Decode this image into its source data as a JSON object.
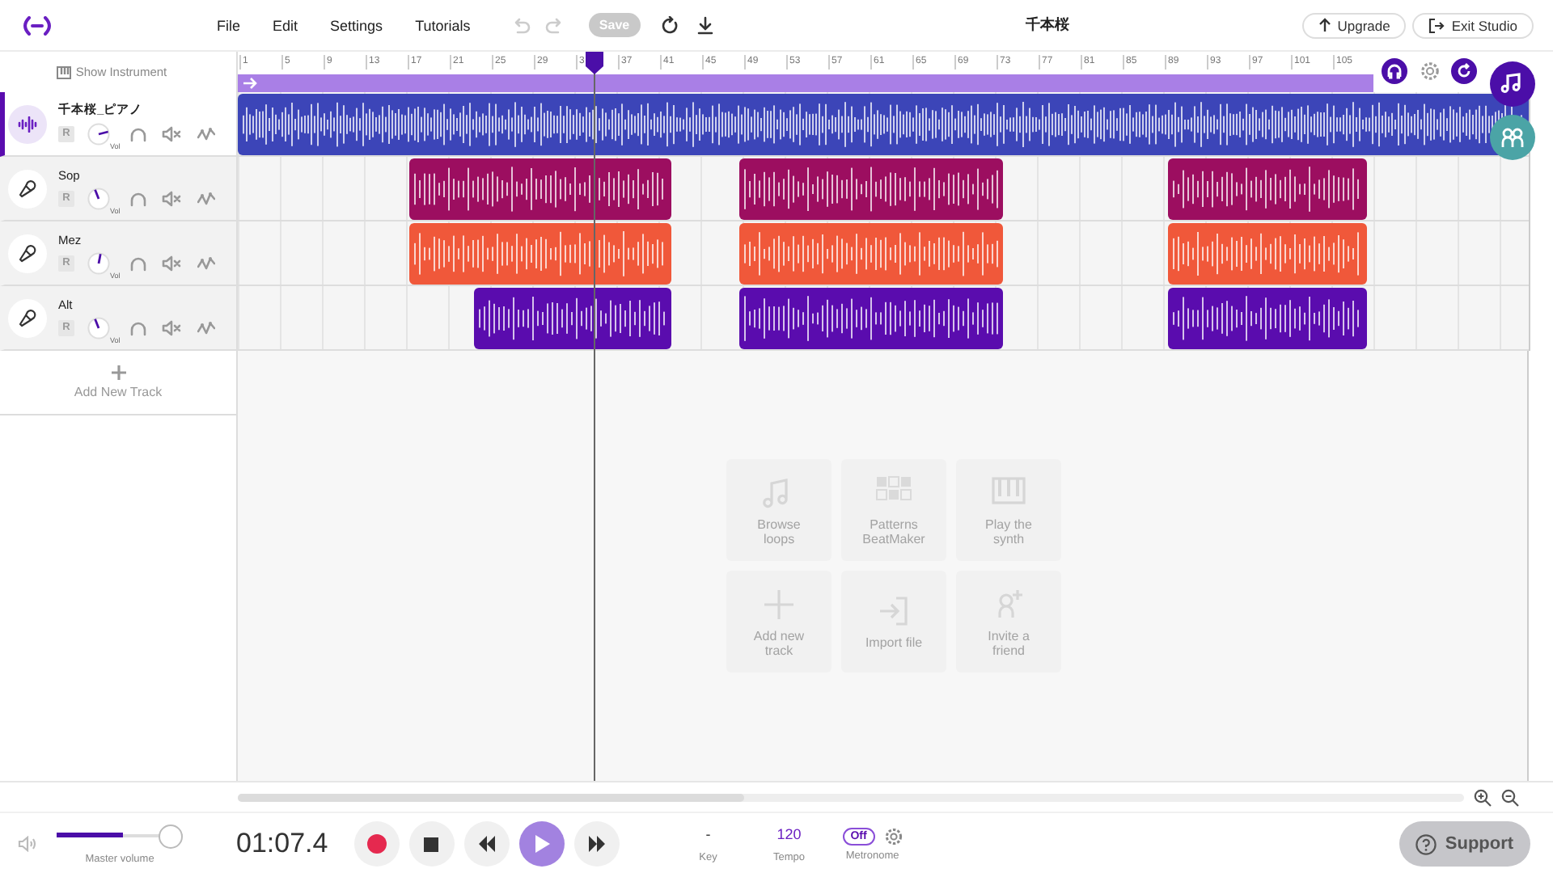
{
  "top_bar": {
    "menu": [
      "File",
      "Edit",
      "Settings",
      "Tutorials"
    ],
    "save": "Save",
    "project_title": "千本桜",
    "upgrade": "Upgrade",
    "exit": "Exit Studio"
  },
  "track_panel": {
    "show_instrument": "Show Instrument",
    "add_track": "Add New Track"
  },
  "ruler": {
    "marks": [
      "1",
      "5",
      "9",
      "13",
      "17",
      "21",
      "25",
      "29",
      "3",
      "37",
      "41",
      "45",
      "49",
      "53",
      "57",
      "61",
      "65",
      "69",
      "73",
      "77",
      "81",
      "85",
      "89",
      "93",
      "97",
      "101",
      "105"
    ]
  },
  "tracks": [
    {
      "name": "千本桜_ピアノ",
      "kind": "instrument",
      "selected": true,
      "record": "R",
      "volume_label": "Vol",
      "level": 0.78,
      "color": "#3c45b8"
    },
    {
      "name": "Sop",
      "kind": "vocal",
      "selected": false,
      "record": "R",
      "volume_label": "Vol",
      "level": 0.42,
      "color": "#9c0e60"
    },
    {
      "name": "Mez",
      "kind": "vocal",
      "selected": false,
      "record": "R",
      "volume_label": "Vol",
      "level": 0.54,
      "color": "#f0583a"
    },
    {
      "name": "Alt",
      "kind": "vocal",
      "selected": false,
      "record": "R",
      "volume_label": "Vol",
      "level": 0.42,
      "color": "#5a0cae"
    }
  ],
  "quick_actions": [
    {
      "kind": "loops",
      "label": "Browse loops"
    },
    {
      "kind": "patterns",
      "label": "Patterns BeatMaker"
    },
    {
      "kind": "synth",
      "label": "Play the synth"
    },
    {
      "kind": "add",
      "label": "Add new track"
    },
    {
      "kind": "import",
      "label": "Import file"
    },
    {
      "kind": "invite",
      "label": "Invite a friend"
    }
  ],
  "transport": {
    "master_volume_label": "Master volume",
    "level": 0.53,
    "time": "01:07.4",
    "key": "-",
    "key_label": "Key",
    "tempo": "120",
    "tempo_label": "Tempo",
    "metronome": "Off",
    "metronome_on": false,
    "metronome_label": "Metronome"
  },
  "support": "Support"
}
